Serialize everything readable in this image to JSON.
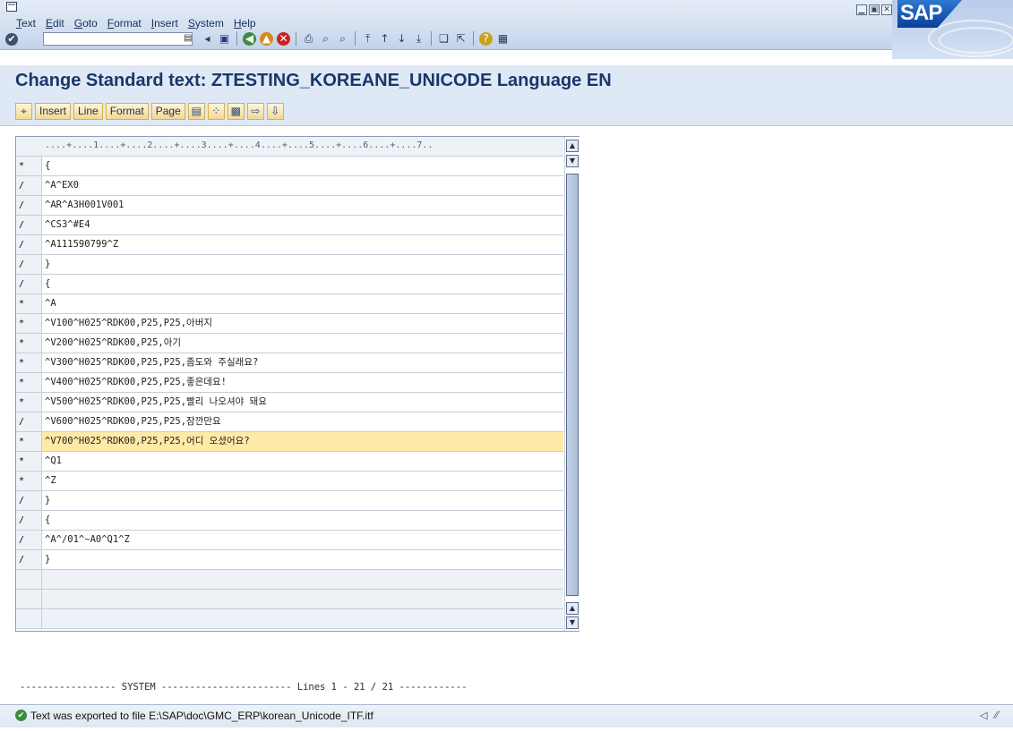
{
  "menubar": {
    "items": [
      "Text",
      "Edit",
      "Goto",
      "Format",
      "Insert",
      "System",
      "Help"
    ],
    "sap_logo": "SAP"
  },
  "toolbar": {
    "command_field_value": "",
    "icons": [
      "enter-icon",
      "save-icon",
      "back-icon",
      "exit-icon",
      "cancel-icon",
      "print-icon",
      "find-icon",
      "find-next-icon",
      "first-page-icon",
      "previous-page-icon",
      "next-page-icon",
      "last-page-icon",
      "create-session-icon",
      "shortcut-icon",
      "help-icon",
      "layout-icon"
    ]
  },
  "title": "Change Standard text: ZTESTING_KOREANE_UNICODE Language EN",
  "app_toolbar": {
    "buttons": [
      "Insert",
      "Line",
      "Format",
      "Page"
    ]
  },
  "editor": {
    "ruler": "....+....1....+....2....+....3....+....4....+....5....+....6....+....7..",
    "lines": [
      {
        "fmt": "*",
        "text": "{"
      },
      {
        "fmt": "/",
        "text": "^A^EX0"
      },
      {
        "fmt": "/",
        "text": "^AR^A3H001V001"
      },
      {
        "fmt": "/",
        "text": "^CS3^#E4"
      },
      {
        "fmt": "/",
        "text": "^A111590799^Z"
      },
      {
        "fmt": "/",
        "text": "}"
      },
      {
        "fmt": "/",
        "text": "{"
      },
      {
        "fmt": "*",
        "text": "^A"
      },
      {
        "fmt": "*",
        "text": "^V100^H025^RDK00,P25,P25,아버지"
      },
      {
        "fmt": "*",
        "text": "^V200^H025^RDK00,P25,아기"
      },
      {
        "fmt": "*",
        "text": "^V300^H025^RDK00,P25,P25,좀도와 주실래요?"
      },
      {
        "fmt": "*",
        "text": "^V400^H025^RDK00,P25,P25,좋은데요!"
      },
      {
        "fmt": "*",
        "text": "^V500^H025^RDK00,P25,P25,빨리 나오셔야 돼요"
      },
      {
        "fmt": "/",
        "text": "^V600^H025^RDK00,P25,P25,잠깐만요"
      },
      {
        "fmt": "*",
        "text": "^V700^H025^RDK00,P25,P25,어디 오셨어요?"
      },
      {
        "fmt": "*",
        "text": "^Q1"
      },
      {
        "fmt": "*",
        "text": "^Z"
      },
      {
        "fmt": "/",
        "text": "}"
      },
      {
        "fmt": "/",
        "text": "{"
      },
      {
        "fmt": "/",
        "text": "^A^/01^~A0^Q1^Z"
      },
      {
        "fmt": "/",
        "text": "}"
      },
      {
        "fmt": "",
        "text": ""
      },
      {
        "fmt": "",
        "text": ""
      },
      {
        "fmt": "",
        "text": ""
      }
    ],
    "selected_line": 14
  },
  "footer": {
    "system_line": "----------------- SYSTEM ----------------------- Lines 1 - 21 / 21 ------------",
    "status_message": "Text was exported to file E:\\SAP\\doc\\GMC_ERP\\korean_Unicode_ITF.itf"
  }
}
